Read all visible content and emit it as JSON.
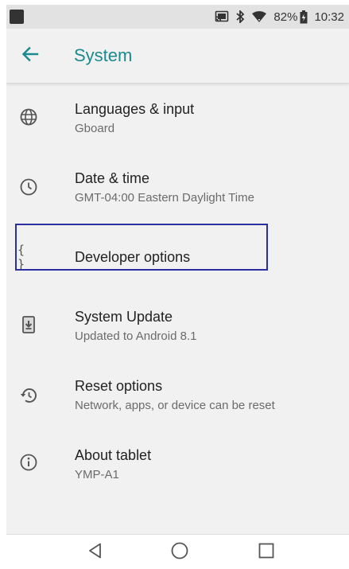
{
  "status_bar": {
    "battery_percent": "82%",
    "time": "10:32",
    "icons": [
      "app-notification-icon",
      "cast-icon",
      "bluetooth-icon",
      "wifi-icon",
      "battery-charging-icon"
    ]
  },
  "app_bar": {
    "title": "System",
    "back_icon": "arrow-back-icon",
    "accent_color": "#1a8a8c"
  },
  "settings": {
    "items": [
      {
        "title": "Languages & input",
        "subtitle": "Gboard",
        "icon": "globe-icon"
      },
      {
        "title": "Date & time",
        "subtitle": "GMT-04:00 Eastern Daylight Time",
        "icon": "clock-icon"
      },
      {
        "title": "Developer options",
        "subtitle": "",
        "icon": "braces-icon",
        "braces_glyph": "{ }",
        "highlighted": true,
        "highlight_color": "#2b2fa0"
      },
      {
        "title": "System Update",
        "subtitle": "Updated to Android 8.1",
        "icon": "system-update-icon"
      },
      {
        "title": "Reset options",
        "subtitle": "Network, apps, or device can be reset",
        "icon": "reset-history-icon"
      },
      {
        "title": "About tablet",
        "subtitle": "YMP-A1",
        "icon": "info-icon"
      }
    ]
  },
  "nav_bar": {
    "icons": [
      "back-triangle-icon",
      "home-circle-icon",
      "recents-square-icon"
    ]
  }
}
